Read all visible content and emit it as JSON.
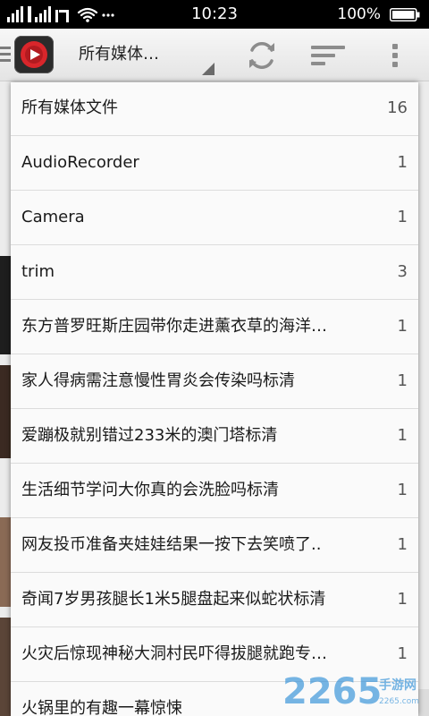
{
  "status_bar": {
    "time": "10:23",
    "battery": "100%",
    "icons": [
      "signal-icon",
      "wifi-icon",
      "more-icon",
      "battery-icon"
    ]
  },
  "action_bar": {
    "dropdown_title": "所有媒体…",
    "icons": [
      "menu-lines-icon",
      "app-icon",
      "dropdown-caret-icon",
      "refresh-icon",
      "sort-icon",
      "overflow-menu-icon"
    ]
  },
  "dropdown": {
    "items": [
      {
        "label": "所有媒体文件",
        "count": "16"
      },
      {
        "label": "AudioRecorder",
        "count": "1"
      },
      {
        "label": "Camera",
        "count": "1"
      },
      {
        "label": "trim",
        "count": "3"
      },
      {
        "label": " 东方普罗旺斯庄园带你走进薰衣草的海洋…",
        "count": "1"
      },
      {
        "label": "家人得病需注意慢性胃炎会传染吗标清",
        "count": "1"
      },
      {
        "label": "爱蹦极就别错过233米的澳门塔标清",
        "count": "1"
      },
      {
        "label": "生活细节学问大你真的会洗脸吗标清",
        "count": "1"
      },
      {
        "label": "网友投币准备夹娃娃结果一按下去笑喷了..",
        "count": "1"
      },
      {
        "label": "奇闻7岁男孩腿长1米5腿盘起来似蛇状标清",
        "count": "1"
      },
      {
        "label": " 火灾后惊现神秘大洞村民吓得拔腿就跑专…",
        "count": "1"
      },
      {
        "label": "火锅里的有趣一幕惊悚",
        "count": ""
      }
    ]
  },
  "watermark": {
    "brand": "2265",
    "sub": "手游网",
    "domain": "2265.com"
  },
  "colors": {
    "status_bar_bg": "#000000",
    "action_bar_bg": "#eeeeee",
    "popup_bg": "#fafafa",
    "app_icon_red": "#d9262b",
    "watermark_blue": "#2f8fd8"
  }
}
